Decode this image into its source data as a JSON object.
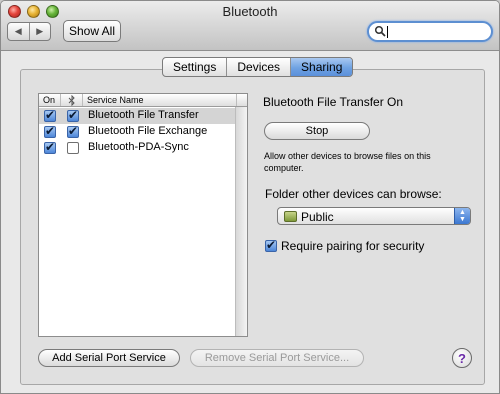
{
  "window": {
    "title": "Bluetooth"
  },
  "toolbar": {
    "back_icon": "◀",
    "forward_icon": "▶",
    "show_all_label": "Show All",
    "search_value": ""
  },
  "tabs": [
    {
      "label": "Settings",
      "active": false
    },
    {
      "label": "Devices",
      "active": false
    },
    {
      "label": "Sharing",
      "active": true
    }
  ],
  "services_table": {
    "headers": {
      "on": "On",
      "alert_icon": "bluetooth-icon",
      "name": "Service Name"
    },
    "rows": [
      {
        "name": "Bluetooth File Transfer",
        "on": true,
        "alert": true,
        "selected": true
      },
      {
        "name": "Bluetooth File Exchange",
        "on": true,
        "alert": true,
        "selected": false
      },
      {
        "name": "Bluetooth-PDA-Sync",
        "on": true,
        "alert": false,
        "selected": false
      }
    ]
  },
  "detail": {
    "status": "Bluetooth File Transfer On",
    "stop_label": "Stop",
    "description": "Allow other devices to browse files on this computer.",
    "folder_label": "Folder other devices can browse:",
    "folder_value": "Public",
    "require_pairing_label": "Require pairing for security",
    "require_pairing_checked": true
  },
  "footer": {
    "add_label": "Add Serial Port Service",
    "remove_label": "Remove Serial Port Service...",
    "help_label": "?"
  },
  "colors": {
    "accent": "#5b90db",
    "selection_row": "#d4d4d4",
    "help_glyph": "#6a2aa8"
  }
}
